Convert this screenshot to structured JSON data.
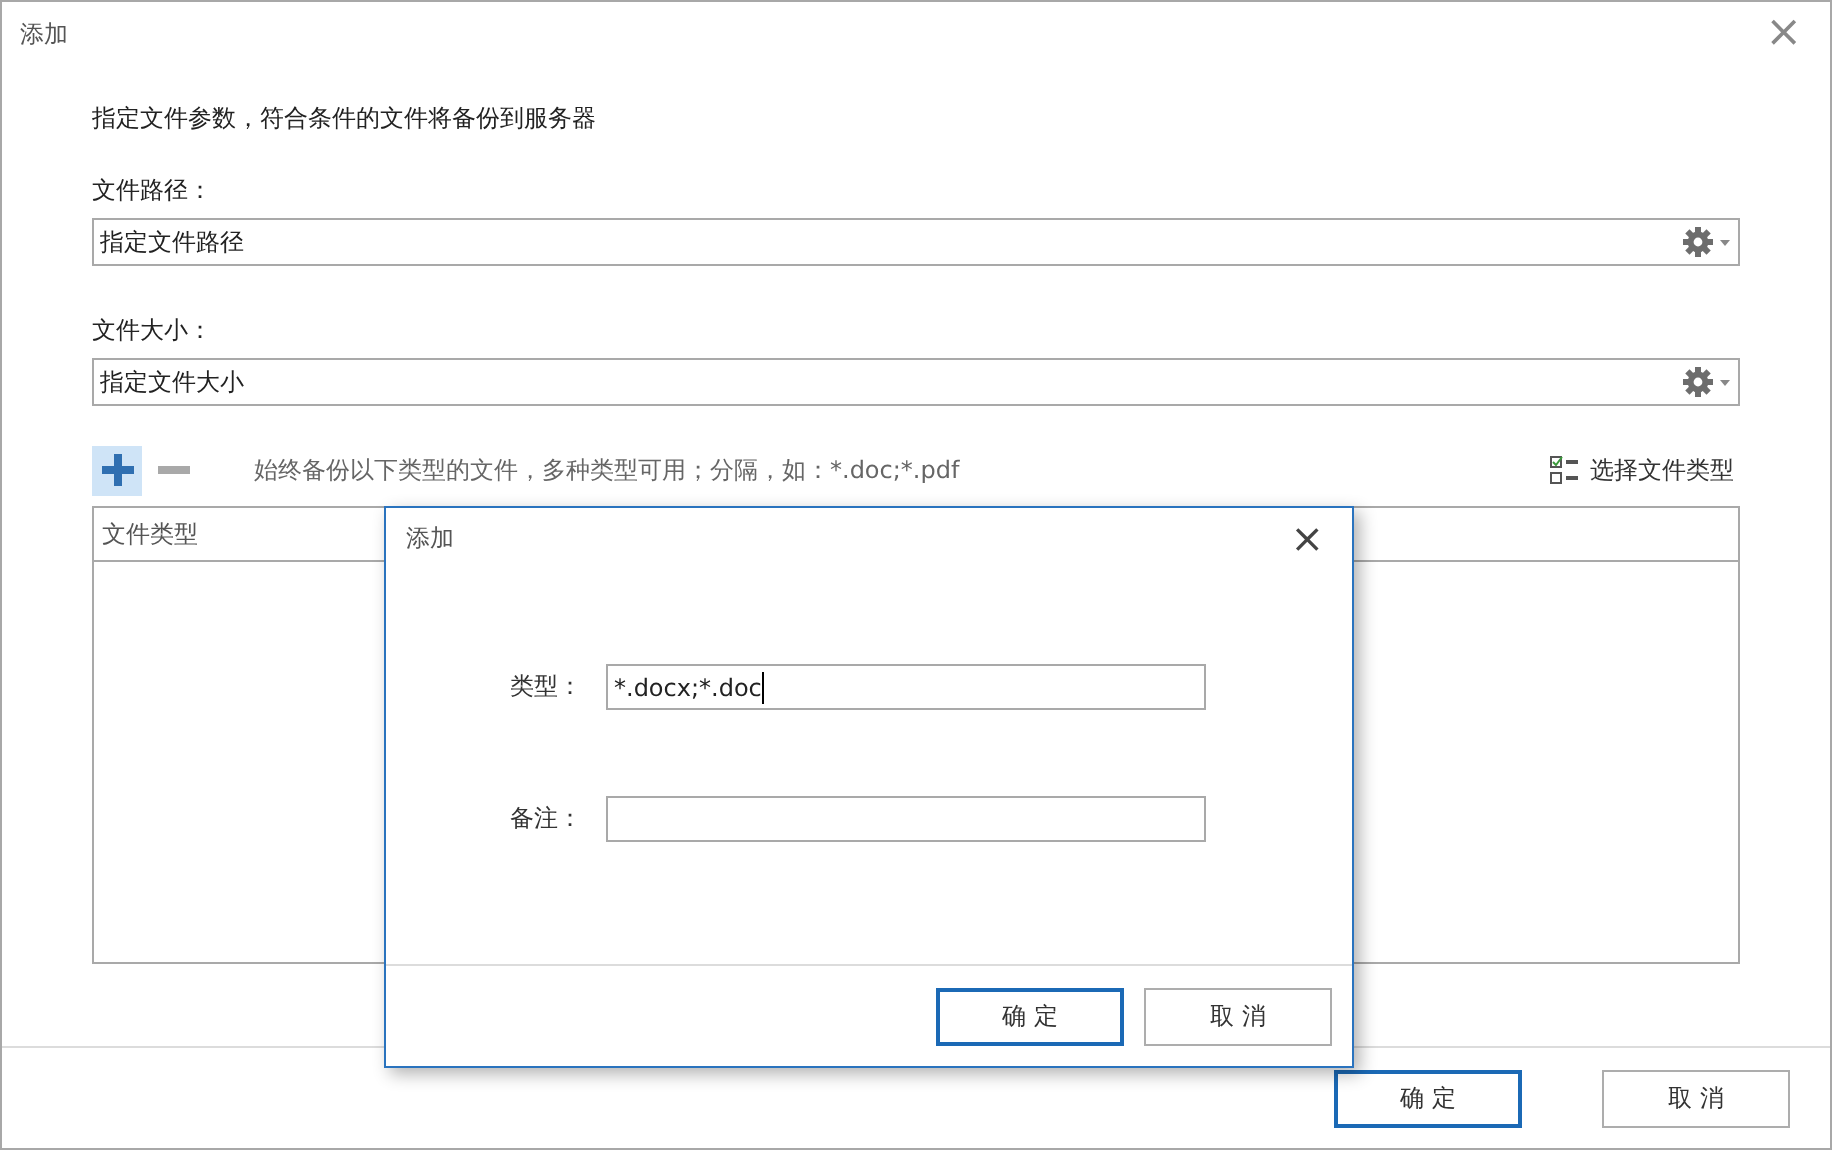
{
  "window": {
    "title": "添加",
    "close": "×"
  },
  "description": "指定文件参数，符合条件的文件将备份到服务器",
  "fields": [
    {
      "label": "文件路径：",
      "value": "指定文件路径"
    },
    {
      "label": "文件大小：",
      "value": "指定文件大小"
    }
  ],
  "toolbar": [
    {
      "kind": "add",
      "highlighted": true
    },
    {
      "kind": "remove",
      "highlighted": false
    }
  ],
  "hint": "始终备份以下类型的文件，多种类型可用；分隔，如：*.doc;*.pdf",
  "select_link": "选择文件类型",
  "table": {
    "columns": [
      "文件类型"
    ]
  },
  "buttons": [
    {
      "label": "确 定",
      "default": true
    },
    {
      "label": "取 消",
      "default": false
    }
  ],
  "dialog": {
    "title": "添加",
    "close": "×",
    "fields": [
      {
        "label": "类型：",
        "value": "*.docx;*.doc",
        "focused": true
      },
      {
        "label": "备注：",
        "focused": false
      }
    ],
    "buttons": [
      {
        "label": "确 定",
        "default": true
      },
      {
        "label": "取 消",
        "default": false
      }
    ]
  }
}
